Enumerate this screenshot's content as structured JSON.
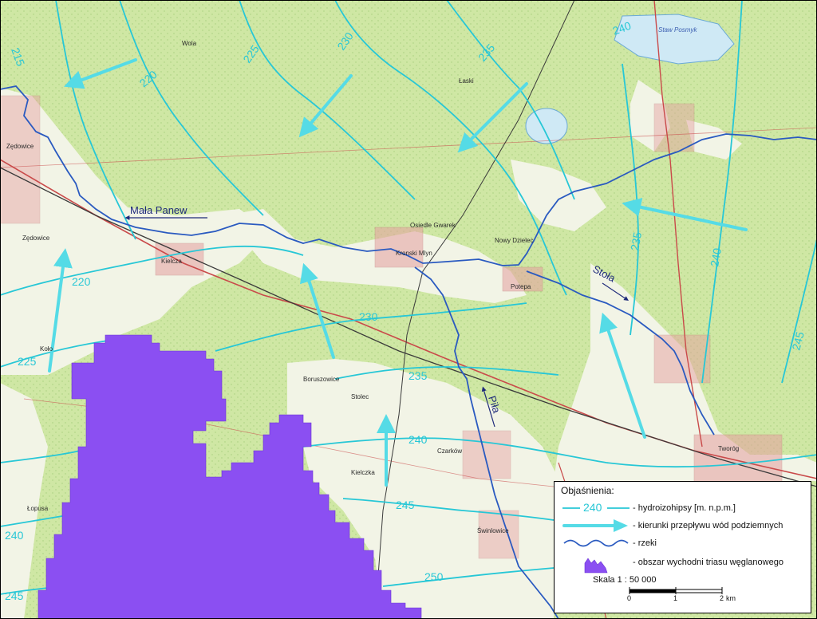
{
  "map": {
    "labels": {
      "river_mala_panew": "Mała Panew",
      "river_stola": "Stoła",
      "river_pila": "Piła"
    },
    "isohypse_labels": [
      "215",
      "220",
      "225",
      "230",
      "235",
      "240",
      "220",
      "225",
      "230",
      "235",
      "240",
      "235",
      "240",
      "245",
      "250",
      "240",
      "245",
      "225"
    ],
    "places": {
      "zedowice": "Zędowice",
      "zedowice2": "Zędowice",
      "kielcza": "Kielcza",
      "osiedle_gwarek": "Osiedle Gwarek",
      "kronski_mlyn": "Kronski Mlyn",
      "potepa": "Potepa",
      "tworog": "Tworóg",
      "boruszowice": "Boruszowice",
      "stolec": "Stolec",
      "czarkow": "Czarków",
      "krupska": "Krupska",
      "swinlowice": "Świnlowice",
      "lopusa": "Łopusa",
      "kolo": "Koło",
      "wola": "Wola",
      "nowy_dzielec": "Nowy Dzielec",
      "kielczka": "Kielczka",
      "laski": "Łaski"
    },
    "lakes": {
      "staw_posmyk": "Staw Posmyk"
    },
    "colors": {
      "forest": "#cfe7a4",
      "clearing": "#f2f4e6",
      "isohypse": "#27c7d6",
      "flow_arrow": "#55dbe6",
      "river": "#2a5ac0",
      "outcrop": "#8b4ff2",
      "road_red": "#c94a4a",
      "rail": "#3a3a3a",
      "settlement": "#e5a0a0"
    }
  },
  "legend": {
    "title": "Objaśnienia:",
    "items": [
      {
        "symbol_label": "240",
        "text": "- hydroizohipsy [m. n.p.m.]"
      },
      {
        "text": "- kierunki przepływu wód podziemnych"
      },
      {
        "text": "- rzeki"
      },
      {
        "text": "- obszar wychodni triasu węglanowego"
      }
    ],
    "scale_title": "Skala 1 : 50 000",
    "scale_ticks": [
      "0",
      "1",
      "2"
    ],
    "scale_unit": "km"
  }
}
